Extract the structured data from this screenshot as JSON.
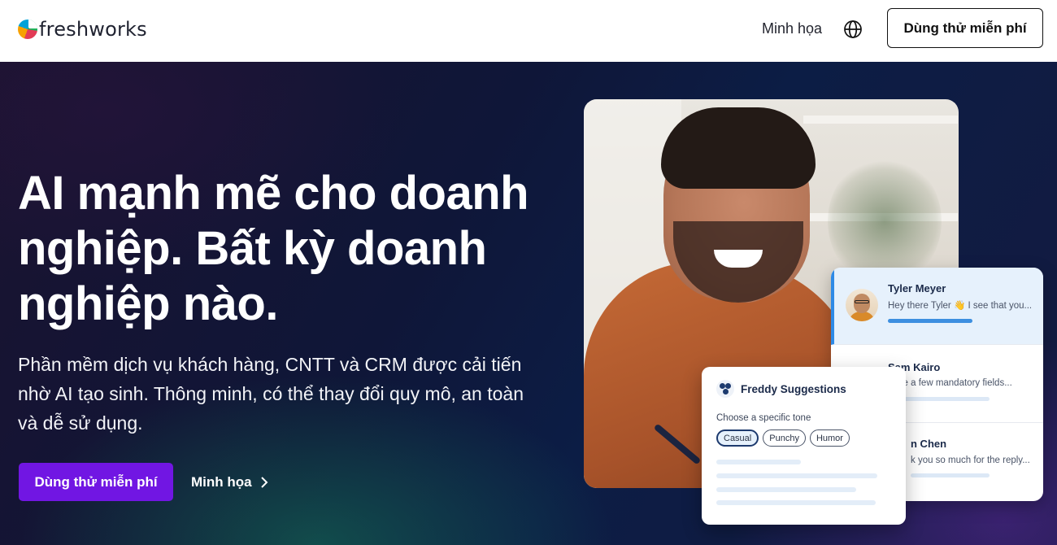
{
  "header": {
    "logo_text": "freshworks",
    "nav_demo": "Minh họa",
    "cta_outline": "Dùng thử miễn phí"
  },
  "hero": {
    "headline": "AI mạnh mẽ cho doanh nghiệp. Bất kỳ doanh nghiệp nào.",
    "subtext": "Phần mềm dịch vụ khách hàng, CNTT và CRM được cải tiến nhờ AI tạo sinh. Thông minh, có thể thay đổi quy mô, an toàn và dễ sử dụng.",
    "cta_primary": "Dùng thử miễn phí",
    "cta_link": "Minh họa"
  },
  "chat_list": {
    "items": [
      {
        "name": "Tyler Meyer",
        "message": "Hey there Tyler 👋 I see that you..."
      },
      {
        "name": "Sam Kairo",
        "message": "have a few mandatory fields..."
      },
      {
        "name": "n Chen",
        "message": "k you so much for the reply..."
      }
    ]
  },
  "freddy": {
    "title": "Freddy Suggestions",
    "label": "Choose a specific tone",
    "chips": [
      "Casual",
      "Punchy",
      "Humor"
    ],
    "selected_chip": "Casual"
  },
  "colors": {
    "accent_purple": "#7116e3",
    "active_blue": "#2e8ae6"
  }
}
